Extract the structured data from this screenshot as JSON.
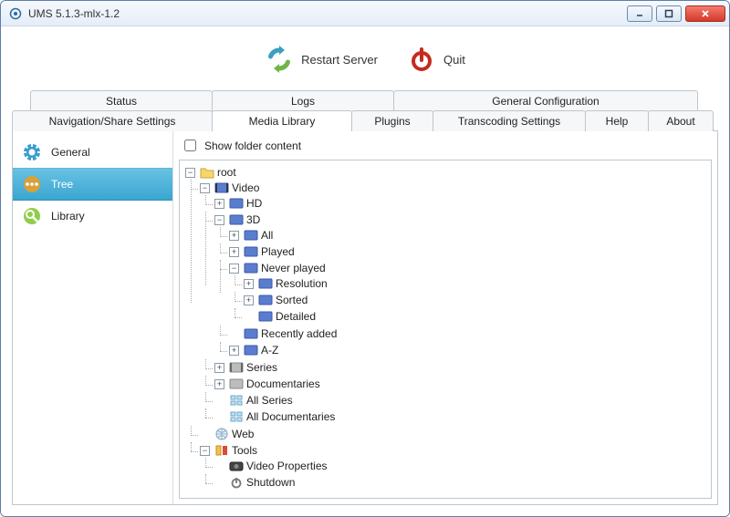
{
  "window": {
    "title": "UMS 5.1.3-mlx-1.2"
  },
  "toolbar": {
    "restart_label": "Restart Server",
    "quit_label": "Quit"
  },
  "tabs_row1": {
    "status": "Status",
    "logs": "Logs",
    "genconf": "General Configuration"
  },
  "tabs_row2": {
    "nav": "Navigation/Share Settings",
    "media": "Media Library",
    "plugins": "Plugins",
    "trans": "Transcoding Settings",
    "help": "Help",
    "about": "About"
  },
  "sidebar": {
    "items": [
      {
        "label": "General"
      },
      {
        "label": "Tree"
      },
      {
        "label": "Library"
      }
    ]
  },
  "show_folder_label": "Show folder content",
  "tree": {
    "root": "root",
    "video": "Video",
    "hd": "HD",
    "three_d": "3D",
    "all": "All",
    "played": "Played",
    "never_played": "Never played",
    "resolution": "Resolution",
    "sorted": "Sorted",
    "detailed": "Detailed",
    "recently_added": "Recently added",
    "a_z": "A-Z",
    "series": "Series",
    "documentaries": "Documentaries",
    "all_series": "All Series",
    "all_docs": "All Documentaries",
    "web": "Web",
    "tools": "Tools",
    "video_props": "Video Properties",
    "shutdown": "Shutdown"
  }
}
